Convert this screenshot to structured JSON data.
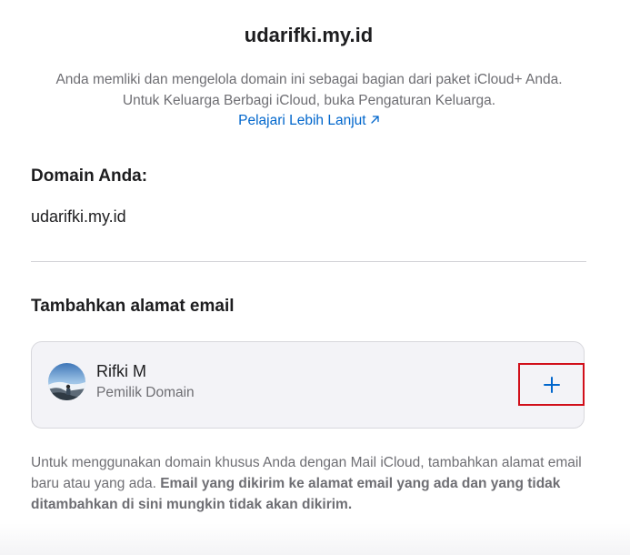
{
  "page": {
    "title": "udarifki.my.id",
    "intro_text": "Anda memliki dan mengelola domain ini sebagai bagian dari paket iCloud+ Anda. Untuk Keluarga Berbagi iCloud, buka Pengaturan Keluarga.",
    "learn_more_label": "Pelajari Lebih Lanjut",
    "learn_more_icon": "arrow-up-right-icon"
  },
  "domain_section": {
    "heading": "Domain Anda:",
    "domain": "udarifki.my.id"
  },
  "email_section": {
    "heading": "Tambahkan alamat email",
    "member": {
      "name": "Rifki M",
      "role": "Pemilik Domain",
      "avatar_icon": "user-photo-avatar"
    },
    "add_button_icon": "plus-icon",
    "footnote_regular": "Untuk menggunakan domain khusus Anda dengan Mail iCloud, tambahkan alamat email baru atau yang ada. ",
    "footnote_bold": "Email yang dikirim ke alamat email yang ada dan yang tidak ditambahkan di sini mungkin tidak akan dikirim."
  },
  "colors": {
    "link": "#0066cc",
    "highlight_border": "#d10f1a",
    "card_background": "#f3f3f7",
    "secondary_text": "#6e6e73"
  }
}
